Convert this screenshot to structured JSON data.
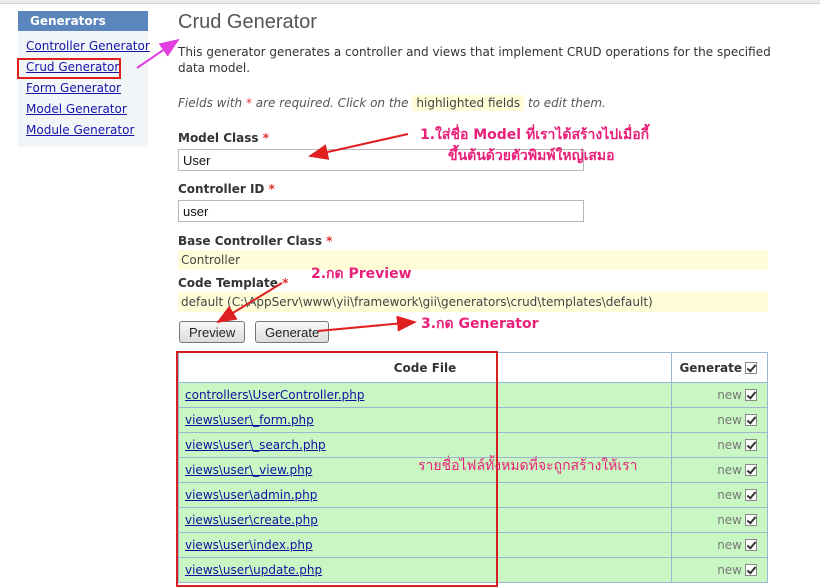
{
  "sidebar": {
    "title": "Generators",
    "items": [
      {
        "label": "Controller Generator"
      },
      {
        "label": "Crud Generator"
      },
      {
        "label": "Form Generator"
      },
      {
        "label": "Model Generator"
      },
      {
        "label": "Module Generator"
      }
    ]
  },
  "main": {
    "title": "Crud Generator",
    "description": "This generator generates a controller and views that implement CRUD operations for the specified data model.",
    "hint_prefix": "Fields with",
    "hint_star": "*",
    "hint_middle": "are required. Click on the",
    "hint_highlight": "highlighted fields",
    "hint_suffix": "to edit them.",
    "fields": {
      "model_class": {
        "label": "Model Class",
        "value": "User"
      },
      "controller_id": {
        "label": "Controller ID",
        "value": "user"
      },
      "base_controller_class": {
        "label": "Base Controller Class",
        "value": "Controller"
      },
      "code_template": {
        "label": "Code Template",
        "value": "default (C:\\AppServ\\www\\yii\\framework\\gii\\generators\\crud\\templates\\default)"
      }
    },
    "required_star": "*",
    "buttons": {
      "preview": "Preview",
      "generate": "Generate"
    },
    "table": {
      "header_file": "Code File",
      "header_generate": "Generate",
      "rows": [
        {
          "file": "controllers\\UserController.php",
          "status": "new"
        },
        {
          "file": "views\\user\\_form.php",
          "status": "new"
        },
        {
          "file": "views\\user\\_search.php",
          "status": "new"
        },
        {
          "file": "views\\user\\_view.php",
          "status": "new"
        },
        {
          "file": "views\\user\\admin.php",
          "status": "new"
        },
        {
          "file": "views\\user\\create.php",
          "status": "new"
        },
        {
          "file": "views\\user\\index.php",
          "status": "new"
        },
        {
          "file": "views\\user\\update.php",
          "status": "new"
        }
      ]
    }
  },
  "annotations": {
    "note1_line1": "1.ใส่ชื่อ Model ที่เราได้สร้างไปเมื่อกี้",
    "note1_line2": "ขึ้นต้นด้วยตัวพิมพ์ใหญ่เสมอ",
    "note2": "2.กด Preview",
    "note3": "3.กด Generator",
    "note4": "รายชื่อไฟล์ทั้งหมดที่จะถูกสร้างให้เรา",
    "annotation_color": "#e8207a",
    "arrow_color": "#e02020",
    "pointer_arrow_color": "#e040e0"
  },
  "colors": {
    "sidebar_header": "#5b86bd",
    "sticky_bg": "#fefdd8",
    "row_bg": "#c9f7c3"
  }
}
